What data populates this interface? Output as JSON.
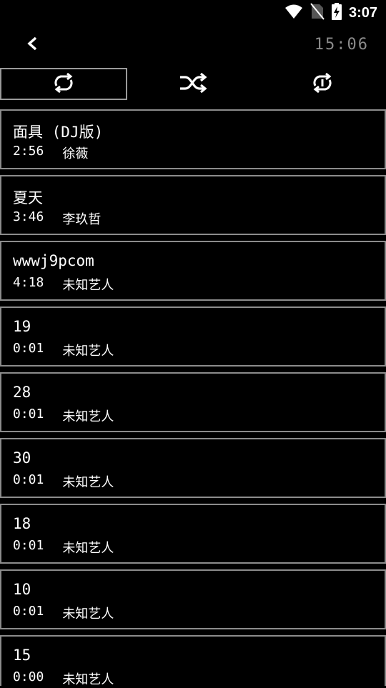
{
  "status_bar": {
    "time": "3:07",
    "icons": [
      "wifi-icon",
      "no-sim-icon",
      "battery-charging-icon"
    ]
  },
  "header": {
    "back_icon": "chevron-left-icon",
    "clock": "15:06"
  },
  "play_modes": [
    {
      "name": "repeat-all",
      "icon": "repeat-icon",
      "active": true
    },
    {
      "name": "shuffle",
      "icon": "shuffle-icon",
      "active": false
    },
    {
      "name": "repeat-one",
      "icon": "repeat-one-icon",
      "active": false
    }
  ],
  "songs": [
    {
      "title": "面具 (DJ版)",
      "duration": "2:56",
      "artist": "徐薇"
    },
    {
      "title": "夏天",
      "duration": "3:46",
      "artist": "李玖哲"
    },
    {
      "title": "wwwj9pcom",
      "duration": "4:18",
      "artist": "未知艺人"
    },
    {
      "title": "19",
      "duration": "0:01",
      "artist": "未知艺人"
    },
    {
      "title": "28",
      "duration": "0:01",
      "artist": "未知艺人"
    },
    {
      "title": "30",
      "duration": "0:01",
      "artist": "未知艺人"
    },
    {
      "title": "18",
      "duration": "0:01",
      "artist": "未知艺人"
    },
    {
      "title": "10",
      "duration": "0:01",
      "artist": "未知艺人"
    },
    {
      "title": "15",
      "duration": "0:00",
      "artist": "未知艺人"
    }
  ],
  "colors": {
    "background": "#000000",
    "border": "#8c8c8c",
    "clock": "#8a8a8a",
    "text": "#ffffff"
  }
}
